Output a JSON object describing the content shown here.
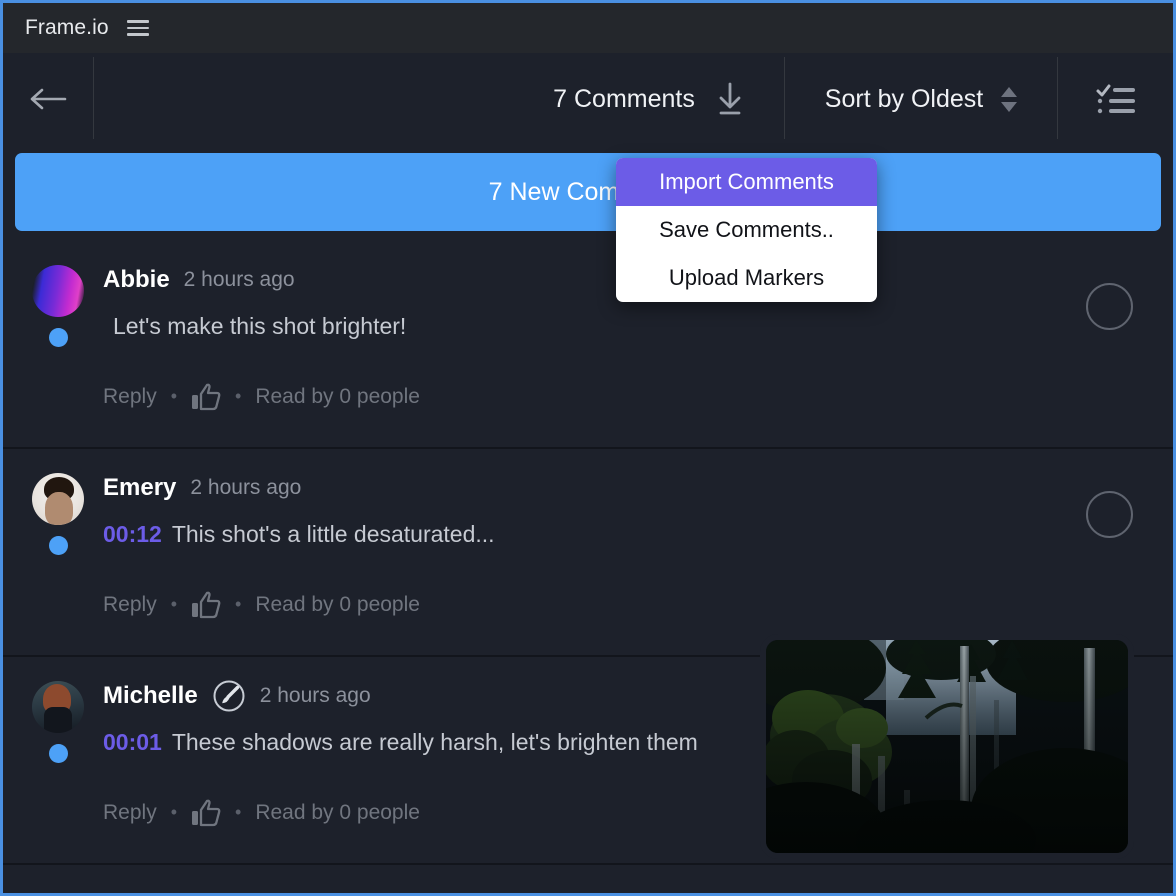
{
  "titlebar": {
    "brand": "Frame.io",
    "menu_icon": "hamburger-icon"
  },
  "toolbar": {
    "back_icon": "back-arrow-icon",
    "comments_count_label": "7 Comments",
    "download_icon": "download-icon",
    "sort_label": "Sort by Oldest",
    "stepper_icon": "sort-stepper-icon",
    "checklist_icon": "checklist-icon"
  },
  "banner": {
    "label": "7 New Comments",
    "color": "#4da1f7"
  },
  "dropdown": {
    "visible": true,
    "active_color": "#6c5ce7",
    "items": [
      {
        "label": "Import Comments",
        "active": true
      },
      {
        "label": "Save Comments..",
        "active": false
      },
      {
        "label": "Upload Markers",
        "active": false
      }
    ]
  },
  "actions": {
    "reply": "Reply",
    "separator": "•",
    "like_icon": "thumbs-up-icon",
    "read_by": "Read by 0 people"
  },
  "comments": [
    {
      "author": "Abbie",
      "avatar": "av-abbie",
      "has_annotation": false,
      "time_ago": "2 hours ago",
      "timecode": "",
      "text": "Let's make this shot brighter!",
      "unread": true,
      "selected": false
    },
    {
      "author": "Emery",
      "avatar": "av-emery",
      "has_annotation": false,
      "time_ago": "2 hours ago",
      "timecode": "00:12",
      "text": "This shot's a little desaturated...",
      "unread": true,
      "selected": false
    },
    {
      "author": "Michelle",
      "avatar": "av-michelle",
      "has_annotation": true,
      "annotation_icon": "paintbrush-icon",
      "time_ago": "2 hours ago",
      "timecode": "00:01",
      "text": "These shadows are really harsh, let's brighten them",
      "unread": true,
      "selected": false
    }
  ],
  "thumbnail": {
    "name": "forest-frame-thumbnail",
    "description": "Dark forest with tall trees"
  },
  "theme": {
    "window_border": "#4a90e2",
    "titlebar_bg": "#24272c",
    "panel_bg": "#1d212b",
    "accent_purple": "#6c5ce7",
    "accent_blue": "#4da1f7"
  }
}
